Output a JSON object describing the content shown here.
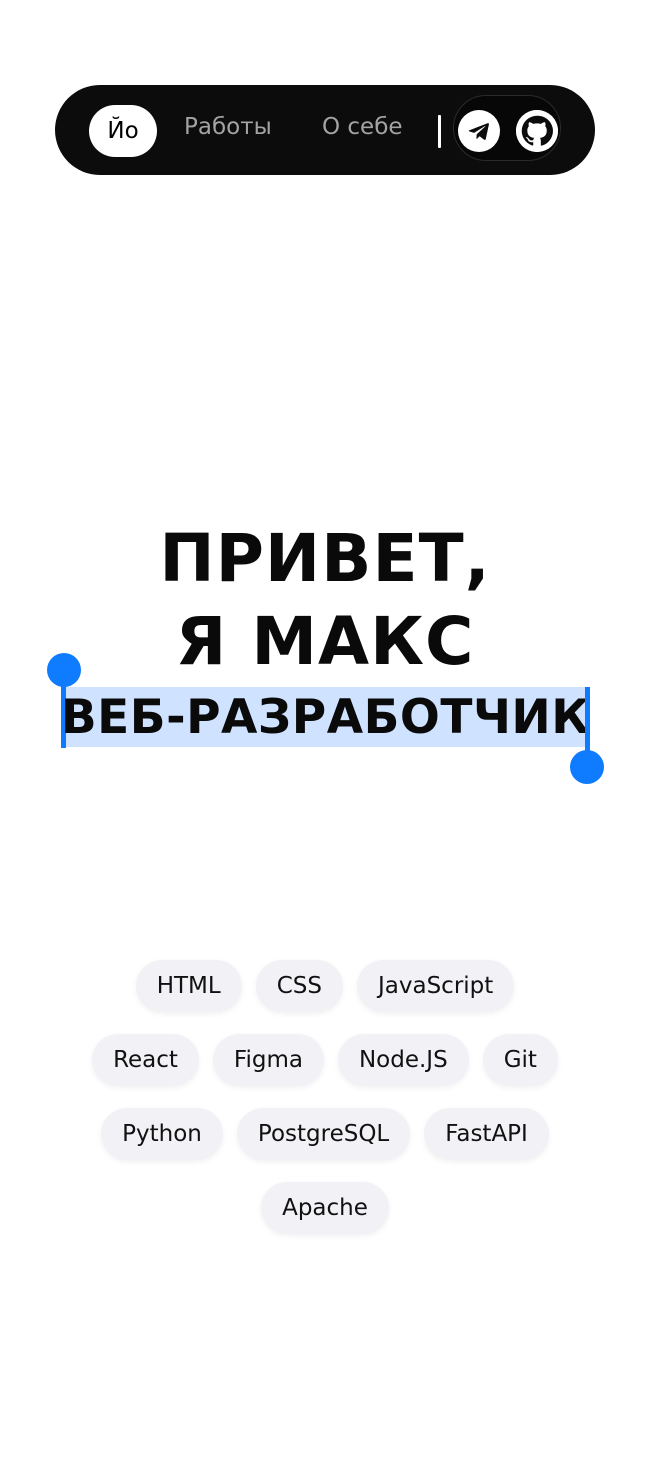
{
  "nav": {
    "home_label": "Йо",
    "links": [
      "Работы",
      "О себе"
    ],
    "social": [
      "telegram-icon",
      "github-icon"
    ]
  },
  "hero": {
    "line1": "ПРИВЕТ,",
    "line2": "Я МАКС",
    "role": "ВЕБ-РАЗРАБОТЧИК",
    "highlight_color": "#cfe2ff",
    "caret_color": "#0f7bff"
  },
  "skills": {
    "rows": [
      [
        "HTML",
        "CSS",
        "JavaScript"
      ],
      [
        "React",
        "Figma",
        "Node.JS",
        "Git"
      ],
      [
        "Python",
        "PostgreSQL",
        "FastAPI"
      ],
      [
        "Apache"
      ]
    ]
  }
}
